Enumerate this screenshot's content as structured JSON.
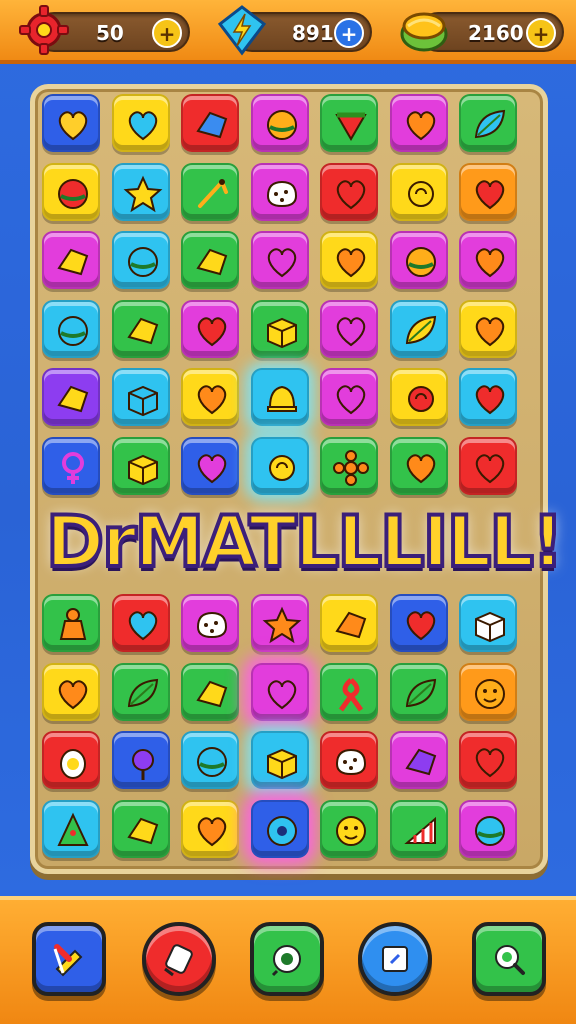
{
  "hud": {
    "resource_1": {
      "icon": "gear-energy-icon",
      "value": "50",
      "badge": "+",
      "badge_color": "#f6c417"
    },
    "resource_2": {
      "icon": "lightning-gem-icon",
      "value": "891",
      "badge": "+",
      "badge_color": "#2a72e6"
    },
    "resource_3": {
      "icon": "fruit-coin-icon",
      "value": "2160",
      "badge": "+",
      "badge_color": "#f6c417"
    }
  },
  "banner": {
    "text": "DrMATLLLILL!"
  },
  "colors": {
    "blue": "#2f5fe8",
    "yellow": "#ffd91a",
    "red": "#ef2c2c",
    "pink": "#e23ddc",
    "green": "#33c24a",
    "orange": "#ff9a1a",
    "cyan": "#2fc3f0",
    "purple": "#8d3df0"
  },
  "board": {
    "rows_top": [
      [
        [
          "blue",
          "heart",
          "#ffce2a"
        ],
        [
          "yellow",
          "heart",
          "#2fc3f0"
        ],
        [
          "red",
          "gem",
          "#3a8cf0"
        ],
        [
          "pink",
          "ball",
          "#ffae1a"
        ],
        [
          "green",
          "slice",
          "#ef2c2c"
        ],
        [
          "pink",
          "heart",
          "#ff8a1a"
        ],
        [
          "green",
          "leaf",
          "#2fc3f0"
        ]
      ],
      [
        [
          "yellow",
          "ball",
          "#ef2c2c"
        ],
        [
          "cyan",
          "star",
          "#ffd91a"
        ],
        [
          "green",
          "sling",
          "#ffae1a"
        ],
        [
          "pink",
          "cookie",
          "#ffffff"
        ],
        [
          "red",
          "heart",
          "#ef2c2c"
        ],
        [
          "yellow",
          "snail",
          "#ffd91a"
        ],
        [
          "orange",
          "heart",
          "#ef2c2c"
        ]
      ],
      [
        [
          "pink",
          "gem",
          "#ffd91a"
        ],
        [
          "cyan",
          "ball",
          "#2fc3f0"
        ],
        [
          "green",
          "gem",
          "#ffd91a"
        ],
        [
          "pink",
          "heart",
          "#e23ddc"
        ],
        [
          "yellow",
          "heart",
          "#ff8a1a"
        ],
        [
          "pink",
          "ball",
          "#ffae1a"
        ],
        [
          "pink",
          "heart",
          "#ff8a1a"
        ]
      ],
      [
        [
          "cyan",
          "ball",
          "#2fc3f0"
        ],
        [
          "green",
          "gem",
          "#ffd91a"
        ],
        [
          "pink",
          "heart",
          "#ef2c2c"
        ],
        [
          "green",
          "box",
          "#ffd91a"
        ],
        [
          "pink",
          "heart",
          "#e23ddc"
        ],
        [
          "cyan",
          "leaf",
          "#ffd91a"
        ],
        [
          "yellow",
          "heart",
          "#ff8a1a"
        ]
      ],
      [
        [
          "purple",
          "gem",
          "#ffd91a"
        ],
        [
          "cyan",
          "box",
          "#2fc3f0"
        ],
        [
          "yellow",
          "heart",
          "#ff8a1a"
        ],
        [
          "cyan",
          "bell",
          "#ffd91a"
        ],
        [
          "pink",
          "heart",
          "#e23ddc"
        ],
        [
          "yellow",
          "snail",
          "#ef2c2c"
        ],
        [
          "cyan",
          "heart",
          "#ef2c2c"
        ]
      ],
      [
        [
          "blue",
          "venus",
          "#e23ddc"
        ],
        [
          "green",
          "box",
          "#ffd91a"
        ],
        [
          "blue",
          "heart",
          "#e23ddc"
        ],
        [
          "cyan",
          "snail",
          "#ffd91a"
        ],
        [
          "green",
          "flower",
          "#ff8a1a"
        ],
        [
          "green",
          "heart",
          "#ff8a1a"
        ],
        [
          "red",
          "heart",
          "#ef2c2c"
        ]
      ]
    ],
    "rows_bottom": [
      [
        [
          "green",
          "gingerbread",
          "#ff8a1a"
        ],
        [
          "red",
          "heart",
          "#2fc3f0"
        ],
        [
          "pink",
          "cookie",
          "#ffffff"
        ],
        [
          "pink",
          "star",
          "#ff8a1a"
        ],
        [
          "yellow",
          "gem",
          "#ff8a1a"
        ],
        [
          "blue",
          "heart",
          "#ef2c2c"
        ],
        [
          "cyan",
          "box",
          "#ffffff"
        ]
      ],
      [
        [
          "yellow",
          "heart",
          "#ff8a1a"
        ],
        [
          "green",
          "leaf",
          "#33c24a"
        ],
        [
          "green",
          "gem",
          "#ffd91a"
        ],
        [
          "pink",
          "heart",
          "#e23ddc"
        ],
        [
          "green",
          "ribbon",
          "#ef2c2c"
        ],
        [
          "green",
          "leaf",
          "#33c24a"
        ],
        [
          "orange",
          "face",
          "#ffae1a"
        ]
      ],
      [
        [
          "red",
          "egg",
          "#ffd91a"
        ],
        [
          "blue",
          "candy",
          "#8d3df0"
        ],
        [
          "cyan",
          "ball",
          "#2fc3f0"
        ],
        [
          "cyan",
          "box",
          "#ffd91a"
        ],
        [
          "red",
          "cookie",
          "#ffffff"
        ],
        [
          "pink",
          "gem",
          "#8d3df0"
        ],
        [
          "red",
          "heart",
          "#ef2c2c"
        ]
      ],
      [
        [
          "cyan",
          "tree",
          "#33c24a"
        ],
        [
          "green",
          "gem",
          "#ffd91a"
        ],
        [
          "yellow",
          "heart",
          "#ff8a1a"
        ],
        [
          "blue",
          "donut",
          "#2fc3f0"
        ],
        [
          "green",
          "face",
          "#ffd91a"
        ],
        [
          "green",
          "ramp",
          "#ef2c2c"
        ],
        [
          "pink",
          "ball",
          "#2fc3f0"
        ]
      ]
    ]
  },
  "toolbar": {
    "buttons": [
      {
        "name": "hammer-button",
        "icon": "hammer-icon",
        "color": "#2f5fe8"
      },
      {
        "name": "shuffle-button",
        "icon": "glove-icon",
        "color": "#ef2c2c"
      },
      {
        "name": "bomb-button",
        "icon": "bomb-icon",
        "color": "#33c24a"
      },
      {
        "name": "swap-button",
        "icon": "card-icon",
        "color": "#2f8ff0"
      },
      {
        "name": "search-button",
        "icon": "magnifier-icon",
        "color": "#33c24a"
      }
    ]
  }
}
